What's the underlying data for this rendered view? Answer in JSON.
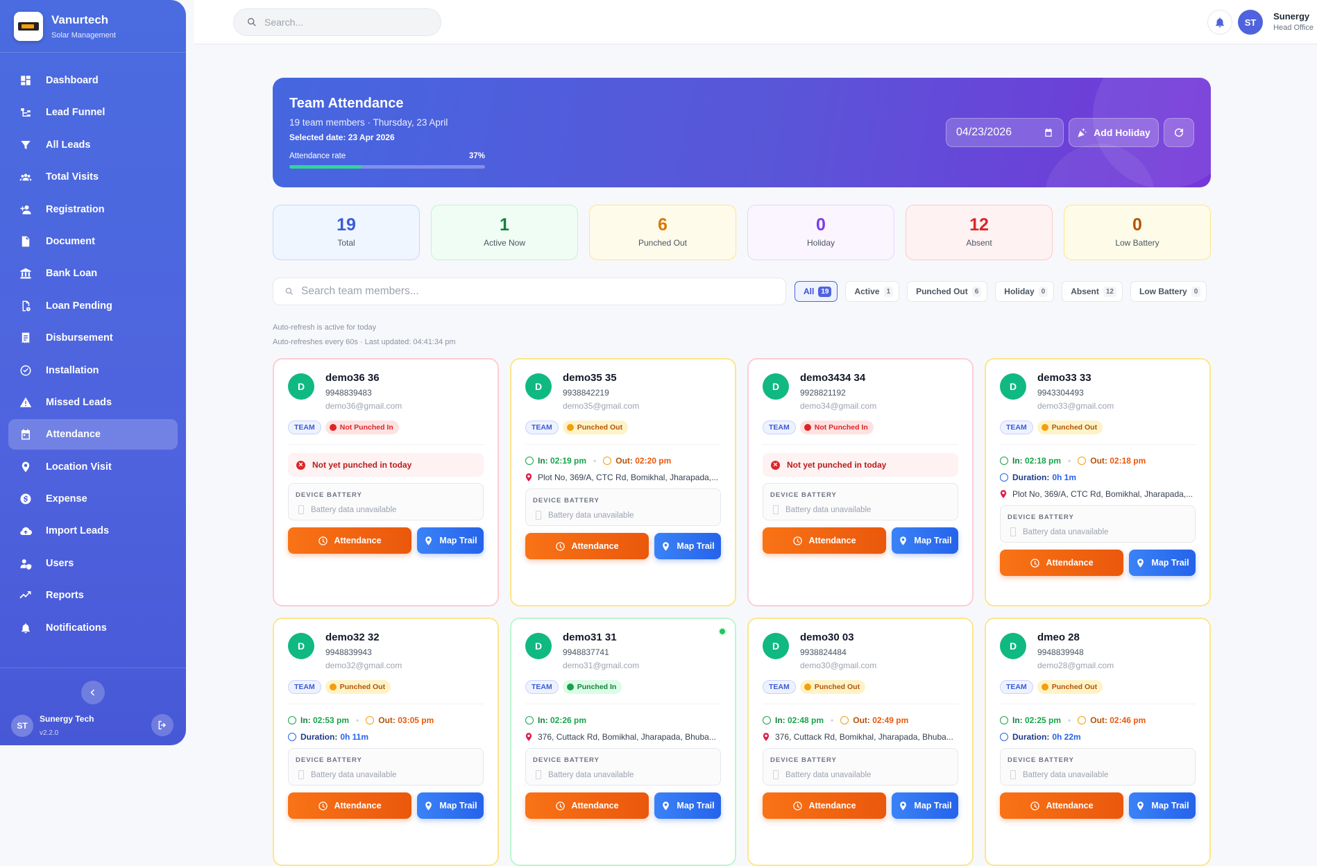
{
  "app": {
    "name": "Vanurtech",
    "subtitle": "Solar Management"
  },
  "sidebar": {
    "items": [
      {
        "label": "Dashboard",
        "icon": "dashboard-icon"
      },
      {
        "label": "Lead Funnel",
        "icon": "funnel-tree-icon"
      },
      {
        "label": "All Leads",
        "icon": "filter-icon"
      },
      {
        "label": "Total Visits",
        "icon": "group-icon"
      },
      {
        "label": "Registration",
        "icon": "person-add-icon"
      },
      {
        "label": "Document",
        "icon": "document-icon"
      },
      {
        "label": "Bank Loan",
        "icon": "bank-icon"
      },
      {
        "label": "Loan Pending",
        "icon": "pending-icon"
      },
      {
        "label": "Disbursement",
        "icon": "receipt-icon"
      },
      {
        "label": "Installation",
        "icon": "check-circle-icon"
      },
      {
        "label": "Missed Leads",
        "icon": "warning-icon"
      },
      {
        "label": "Attendance",
        "icon": "calendar-icon",
        "active": true
      },
      {
        "label": "Location Visit",
        "icon": "location-pin-icon"
      },
      {
        "label": "Expense",
        "icon": "dollar-icon"
      },
      {
        "label": "Import Leads",
        "icon": "cloud-upload-icon"
      },
      {
        "label": "Users",
        "icon": "users-shield-icon"
      },
      {
        "label": "Reports",
        "icon": "trend-icon"
      },
      {
        "label": "Notifications",
        "icon": "bell-icon"
      }
    ],
    "user": {
      "initials": "ST",
      "name": "Sunergy Tech",
      "version": "v2.2.0"
    }
  },
  "topbar": {
    "search_placeholder": "Search...",
    "user_initials": "ST",
    "user_name": "Sunergy",
    "user_role": "Head Office"
  },
  "hero": {
    "title": "Team Attendance",
    "subtitle": "19 team members · Thursday, 23 April",
    "selected": "Selected date: 23 Apr 2026",
    "rate_label": "Attendance rate",
    "rate_text": "37%",
    "rate_value": 0.37,
    "date_value": "04/23/2026",
    "add_holiday": "Add Holiday"
  },
  "stats": [
    {
      "value": "19",
      "label": "Total",
      "color": "#3b5bd6",
      "bg": "#eff6ff",
      "border": "#bfdbfe"
    },
    {
      "value": "1",
      "label": "Active Now",
      "color": "#15803d",
      "bg": "#f0fdf4",
      "border": "#bbf7d0"
    },
    {
      "value": "6",
      "label": "Punched Out",
      "color": "#d97706",
      "bg": "#fffbeb",
      "border": "#fde68a"
    },
    {
      "value": "0",
      "label": "Holiday",
      "color": "#7c3aed",
      "bg": "#faf5ff",
      "border": "#e9d5ff"
    },
    {
      "value": "12",
      "label": "Absent",
      "color": "#dc2626",
      "bg": "#fef2f2",
      "border": "#fecaca"
    },
    {
      "value": "0",
      "label": "Low Battery",
      "color": "#b45309",
      "bg": "#fefce8",
      "border": "#fde68a"
    }
  ],
  "filters": {
    "search_placeholder": "Search team members...",
    "chips": [
      {
        "label": "All",
        "count": "19"
      },
      {
        "label": "Active",
        "count": "1"
      },
      {
        "label": "Punched Out",
        "count": "6"
      },
      {
        "label": "Holiday",
        "count": "0"
      },
      {
        "label": "Absent",
        "count": "12"
      },
      {
        "label": "Low Battery",
        "count": "0"
      }
    ]
  },
  "auto": {
    "line1": "Auto-refresh is active for today",
    "line2": "Auto-refreshes every 60s · Last updated: 04:41:34 pm"
  },
  "labels": {
    "team": "TEAM",
    "not_yet": "Not yet punched in today",
    "device_battery": "DEVICE BATTERY",
    "battery_na": "Battery data unavailable",
    "attendance_btn": "Attendance",
    "map_btn": "Map Trail",
    "in": "In:",
    "out": "Out:",
    "duration": "Duration:"
  },
  "members": [
    {
      "initial": "D",
      "name": "demo36 36",
      "phone": "9948839483",
      "email": "demo36@gmail.com",
      "status": "Not Punched In"
    },
    {
      "initial": "D",
      "name": "demo35 35",
      "phone": "9938842219",
      "email": "demo35@gmail.com",
      "status": "Punched Out",
      "in": "02:19 pm",
      "out": "02:20 pm",
      "address": "Plot No, 369/A, CTC Rd, Bomikhal, Jharapada,..."
    },
    {
      "initial": "D",
      "name": "demo3434 34",
      "phone": "9928821192",
      "email": "demo34@gmail.com",
      "status": "Not Punched In"
    },
    {
      "initial": "D",
      "name": "demo33 33",
      "phone": "9943304493",
      "email": "demo33@gmail.com",
      "status": "Punched Out",
      "in": "02:18 pm",
      "out": "02:18 pm",
      "duration": "0h 1m",
      "address": "Plot No, 369/A, CTC Rd, Bomikhal, Jharapada,..."
    },
    {
      "initial": "D",
      "name": "demo32 32",
      "phone": "9948839943",
      "email": "demo32@gmail.com",
      "status": "Punched Out",
      "in": "02:53 pm",
      "out": "03:05 pm",
      "duration": "0h 11m"
    },
    {
      "initial": "D",
      "name": "demo31 31",
      "phone": "9948837741",
      "email": "demo31@gmail.com",
      "status": "Punched In",
      "in": "02:26 pm",
      "address": "376, Cuttack Rd, Bomikhal, Jharapada, Bhuba..."
    },
    {
      "initial": "D",
      "name": "demo30 03",
      "phone": "9938824484",
      "email": "demo30@gmail.com",
      "status": "Punched Out",
      "in": "02:48 pm",
      "out": "02:49 pm",
      "address": "376, Cuttack Rd, Bomikhal, Jharapada, Bhuba..."
    },
    {
      "initial": "D",
      "name": "dmeo 28",
      "phone": "9948839948",
      "email": "demo28@gmail.com",
      "status": "Punched Out",
      "in": "02:25 pm",
      "out": "02:46 pm",
      "duration": "0h 22m"
    }
  ]
}
